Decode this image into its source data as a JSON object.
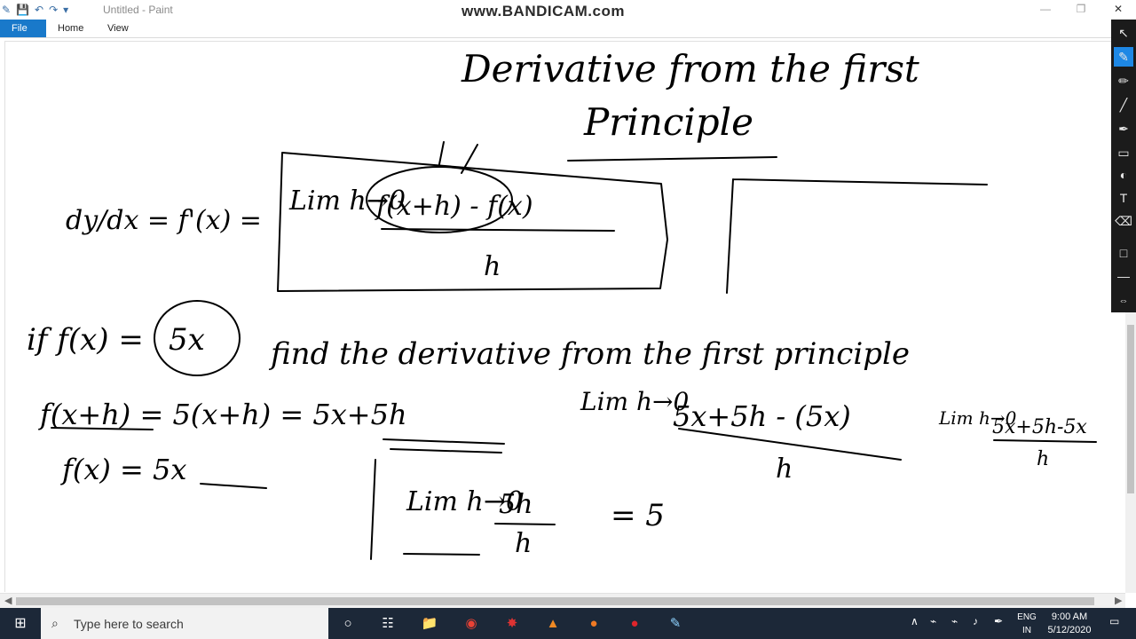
{
  "window": {
    "title": "Untitled - Paint",
    "watermark": "www.BANDICAM.com",
    "minimize_glyph": "—",
    "restore_glyph": "❐",
    "close_glyph": "✕"
  },
  "quick_access": {
    "paint_icon": "✎",
    "save_icon": "💾",
    "undo_icon": "↶",
    "redo_icon": "↷",
    "dropdown_icon": "▾"
  },
  "ribbon": {
    "tabs": [
      {
        "label": "File"
      },
      {
        "label": "Home"
      },
      {
        "label": "View"
      }
    ]
  },
  "tools": [
    {
      "name": "select-icon",
      "glyph": "↖"
    },
    {
      "name": "pen-icon",
      "glyph": "✎"
    },
    {
      "name": "highlighter-icon",
      "glyph": "✏"
    },
    {
      "name": "line-icon",
      "glyph": "╱"
    },
    {
      "name": "brush-icon",
      "glyph": "✒"
    },
    {
      "name": "rectangle-icon",
      "glyph": "▭"
    },
    {
      "name": "color-palette-icon",
      "glyph": "◐"
    },
    {
      "name": "text-icon",
      "glyph": "T"
    },
    {
      "name": "eraser-icon",
      "glyph": "⌫"
    },
    {
      "name": "fill-box-icon",
      "glyph": "□"
    },
    {
      "name": "line-width-icon",
      "glyph": "—"
    },
    {
      "name": "expand-icon",
      "glyph": "⇔"
    }
  ],
  "handwriting": {
    "title_line1": "Derivative from the first",
    "title_line2": "Principle",
    "definition_lhs": "dy/dx = f'(x) =",
    "definition_lim": "Lim h→0",
    "definition_numerator": "f(x+h) - f(x)",
    "definition_denominator": "h",
    "problem_if": "if f(x) =",
    "problem_value": "5x",
    "problem_text": "find the derivative from the first principle",
    "step1": "f(x+h) = 5(x+h) = 5x+5h",
    "step2": "f(x) = 5x",
    "step3_lim": "Lim h→0",
    "step3_expr": "5x+5h - (5x)",
    "step3_denominator": "h",
    "step3_lim2": "Lim h→0",
    "step3_expr2": "5x+5h-5x",
    "step3_den2": "h",
    "step4_lim": "Lim h→0",
    "step4_num": "5h",
    "step4_den": "h",
    "result": "= 5"
  },
  "taskbar": {
    "search_placeholder": "Type here to search",
    "lang_line1": "ENG",
    "lang_line2": "IN",
    "time": "9:00 AM",
    "date": "5/12/2020",
    "start_glyph": "⊞",
    "search_glyph": "⌕",
    "cortana_glyph": "○",
    "taskview_glyph": "☷",
    "explorer_glyph": "📁",
    "chrome_glyph": "◉",
    "app1_glyph": "✸",
    "vlc_glyph": "▲",
    "app2_glyph": "●",
    "record_glyph": "●",
    "paint_glyph": "✎",
    "chevron_glyph": "∧",
    "network_glyph": "⌁",
    "volume_glyph": "♪",
    "pen_glyph": "✒",
    "notif_glyph": "▭"
  },
  "colors": {
    "file_tab": "#1979ca",
    "taskbar": "#1c2838",
    "tool_active": "#1e88e5",
    "ink": "#000000"
  }
}
